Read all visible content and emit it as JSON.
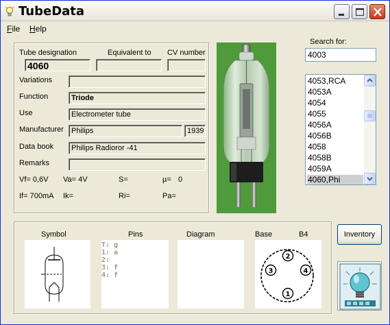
{
  "window": {
    "title": "TubeData"
  },
  "menu": {
    "file": "File",
    "file_ul": "F",
    "file_rest": "ile",
    "help": "Help",
    "help_ul": "H",
    "help_rest": "elp"
  },
  "headers": {
    "tube_designation": "Tube designation",
    "equivalent_to": "Equivalent to",
    "cv_number": "CV number"
  },
  "values": {
    "tube_designation": "4060",
    "equivalent_to": "",
    "cv_number": "",
    "variations": "",
    "function": "Triode",
    "use": "Electrometer tube",
    "manufacturer": "Philips",
    "year": "1939",
    "data_book": "Philips Radioror -41",
    "remarks": ""
  },
  "labels": {
    "variations": "Variations",
    "function": "Function",
    "use": "Use",
    "manufacturer": "Manufacturer",
    "data_book": "Data book",
    "remarks": "Remarks"
  },
  "params": {
    "vf": "Vf= 0,6V",
    "va": "Va= 4V",
    "s": "S=",
    "mu": "µ=",
    "mu_value": "0",
    "if": "If= 700mA",
    "ik": "Ik=",
    "ri": "Ri=",
    "pa": "Pa="
  },
  "search": {
    "label": "Search for:",
    "value": "4003"
  },
  "tube_list": {
    "items": [
      "4053,RCA",
      "4053A",
      "4054",
      "4055",
      "4056A",
      "4056B",
      "4058",
      "4058B",
      "4059A",
      "4060,Phi"
    ],
    "selected_index": 9
  },
  "bottom_headers": {
    "symbol": "Symbol",
    "pins": "Pins",
    "diagram": "Diagram",
    "base": "Base",
    "base_type": "B4"
  },
  "pins": [
    "T: g",
    "1: a",
    "2:",
    "3: f",
    "4: f"
  ],
  "base_pins": [
    "2",
    "3",
    "4",
    "1"
  ],
  "buttons": {
    "inventory": "Inventory"
  },
  "colors": {
    "titlebar_close": "#c7381c",
    "photo_bg": "#4f9a3a",
    "selection": "#d0d0d0",
    "field_bg": "#ece9d8"
  }
}
